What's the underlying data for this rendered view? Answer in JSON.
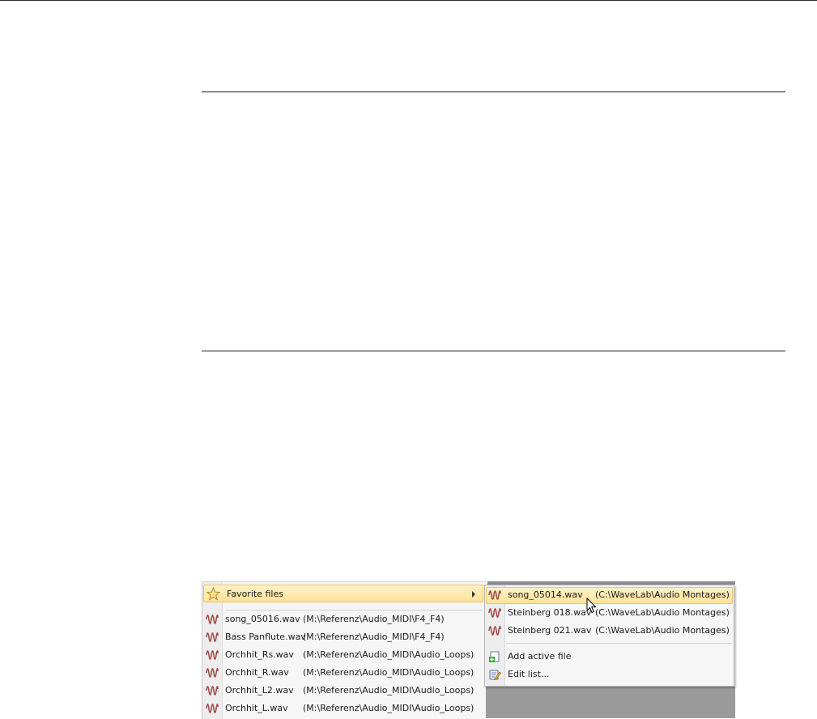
{
  "menu": {
    "favorite_label": "Favorite files",
    "recent_files": [
      {
        "name": "song_05016.wav",
        "path": "(M:\\Referenz\\Audio_MIDI\\F4_F4)"
      },
      {
        "name": "Bass Panflute.wav",
        "path": "(M:\\Referenz\\Audio_MIDI\\F4_F4)"
      },
      {
        "name": "Orchhit_Rs.wav",
        "path": "(M:\\Referenz\\Audio_MIDI\\Audio_Loops)"
      },
      {
        "name": "Orchhit_R.wav",
        "path": "(M:\\Referenz\\Audio_MIDI\\Audio_Loops)"
      },
      {
        "name": "Orchhit_L2.wav",
        "path": "(M:\\Referenz\\Audio_MIDI\\Audio_Loops)"
      },
      {
        "name": "Orchhit_L.wav",
        "path": "(M:\\Referenz\\Audio_MIDI\\Audio_Loops)"
      }
    ]
  },
  "submenu": {
    "favorites": [
      {
        "name": "song_05014.wav",
        "path": "(C:\\WaveLab\\Audio Montages)"
      },
      {
        "name": "Steinberg 018.wav",
        "path": "(C:\\WaveLab\\Audio Montages)"
      },
      {
        "name": "Steinberg 021.wav",
        "path": "(C:\\WaveLab\\Audio Montages)"
      }
    ],
    "add_active_file": "Add active file",
    "edit_list": "Edit list..."
  },
  "icons": {
    "favorite": "star-icon",
    "file": "waveform-icon",
    "add": "add-file-icon",
    "edit": "edit-list-icon",
    "pointer": "mouse-cursor-icon"
  },
  "colors": {
    "highlight": "#fde29a",
    "highlight_border": "#e9c46d",
    "waveform": "#a64b4b"
  }
}
